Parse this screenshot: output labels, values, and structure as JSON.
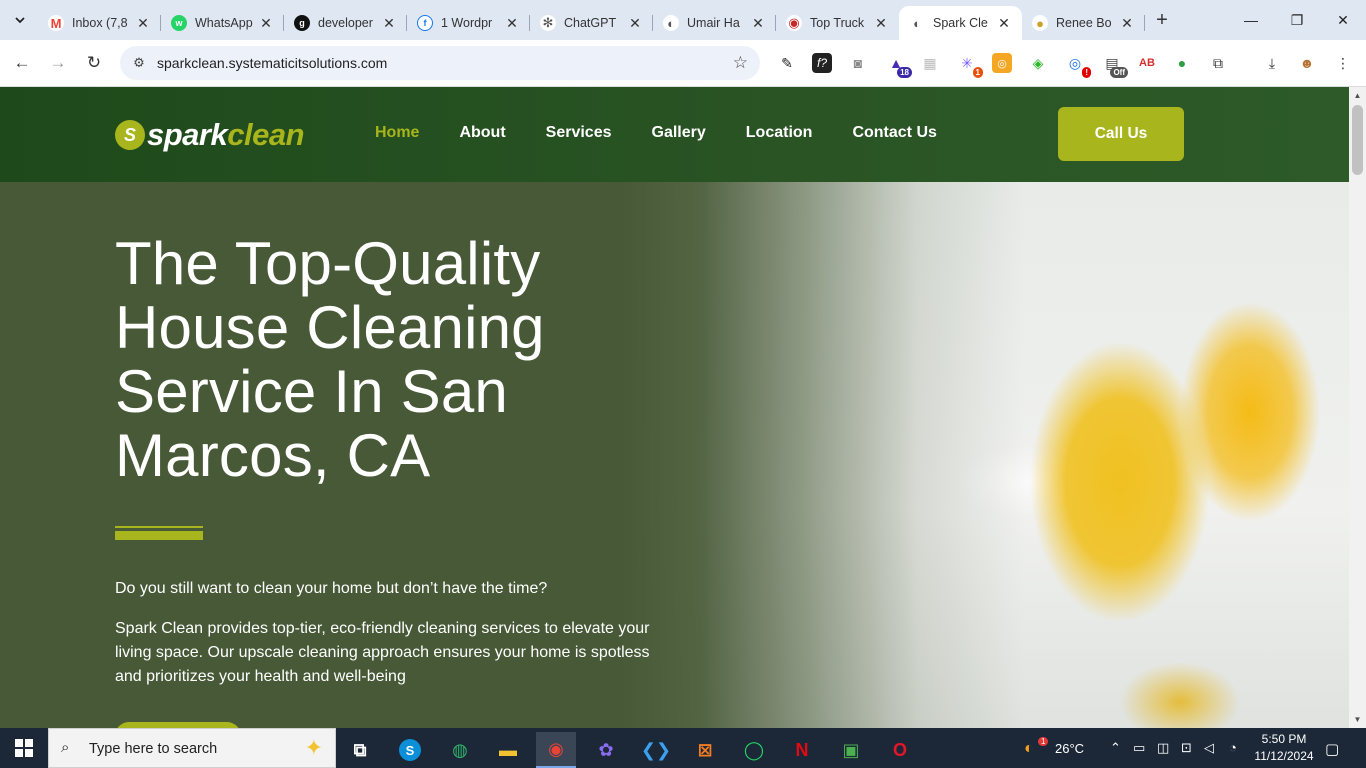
{
  "browser": {
    "tabs": [
      {
        "title": "Inbox (7,8",
        "fav": "M",
        "fav_color": "#ea4335"
      },
      {
        "title": "WhatsApp",
        "fav": "w",
        "fav_color": "#25d366"
      },
      {
        "title": "developer",
        "fav": "g",
        "fav_color": "#111111"
      },
      {
        "title": "1 Wordpr",
        "fav": "f",
        "fav_color": "#1877f2"
      },
      {
        "title": "ChatGPT",
        "fav": "✻",
        "fav_color": "#555555"
      },
      {
        "title": "Umair Ha",
        "fav": "◐",
        "fav_color": "#555555"
      },
      {
        "title": "Top Truck",
        "fav": "◉",
        "fav_color": "#c62828"
      },
      {
        "title": "Spark Cle",
        "fav": "◐",
        "fav_color": "#555555"
      },
      {
        "title": "Renee Bo",
        "fav": "●",
        "fav_color": "#c9a227"
      }
    ],
    "url": "sparkclean.systematicitsolutions.com",
    "extension_badges": {
      "ext_1": "18",
      "ext_2": "1",
      "ext_3": "!",
      "ext_4": "Off"
    }
  },
  "site": {
    "logo_part1": "spark",
    "logo_part2": "clean",
    "nav": [
      "Home",
      "About",
      "Services",
      "Gallery",
      "Location",
      "Contact Us"
    ],
    "call_label": "Call Us",
    "hero_title": "The Top-Quality House Cleaning Service In San Marcos, CA",
    "hero_question": "Do you still want to clean your home but don’t have the time?",
    "hero_description": "Spark Clean provides top-tier, eco-friendly cleaning services to elevate your living space. Our upscale cleaning approach ensures your home is spotless and prioritizes your health and well-being",
    "accent_color": "#a8b51c",
    "header_color": "#1e4a1b"
  },
  "taskbar": {
    "search_placeholder": "Type here to search",
    "weather_temp": "26°C",
    "weather_badge": "1",
    "time": "5:50 PM",
    "date": "11/12/2024"
  }
}
